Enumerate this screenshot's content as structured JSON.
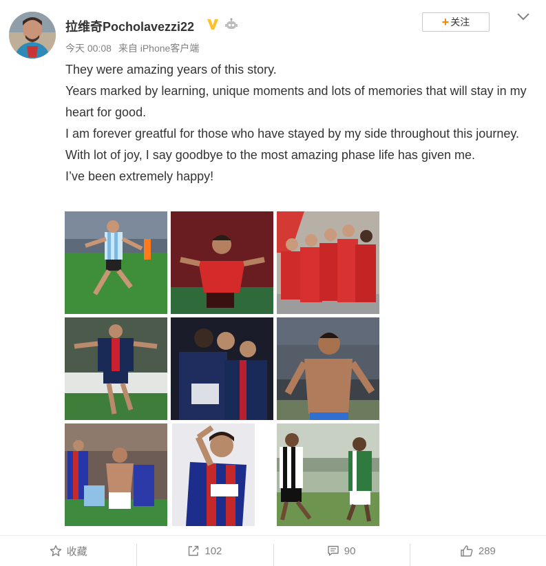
{
  "user": {
    "name": "拉维奇Pocholavezzi22",
    "time": "今天 00:08",
    "source": "来自 iPhone客户端"
  },
  "follow_label": "关注",
  "post": {
    "lines": [
      "They were amazing years of this story.",
      "Years marked by learning, unique moments and lots of memories that will stay in my heart for good.",
      "I am forever greatful for those who have stayed by my side throughout this journey.",
      "With lot of joy, I say goodbye to the most amazing phase life has given me.",
      "I’ve been extremely happy!"
    ]
  },
  "photos": [
    {
      "name": "photo-argentina"
    },
    {
      "name": "photo-red-kit-celebration"
    },
    {
      "name": "photo-team-huddle"
    },
    {
      "name": "photo-psg-celebration"
    },
    {
      "name": "photo-psg-teammates"
    },
    {
      "name": "photo-shirtless-celebration"
    },
    {
      "name": "photo-san-lorenzo-celebration"
    },
    {
      "name": "photo-san-lorenzo-jersey"
    },
    {
      "name": "photo-striped-kit-match"
    }
  ],
  "actions": {
    "favorite_label": "收藏",
    "repost_count": "102",
    "comment_count": "90",
    "like_count": "289"
  },
  "colors": {
    "accent": "#ff8200",
    "verified": "#ffc12b",
    "text": "#333333",
    "muted": "#808080"
  }
}
